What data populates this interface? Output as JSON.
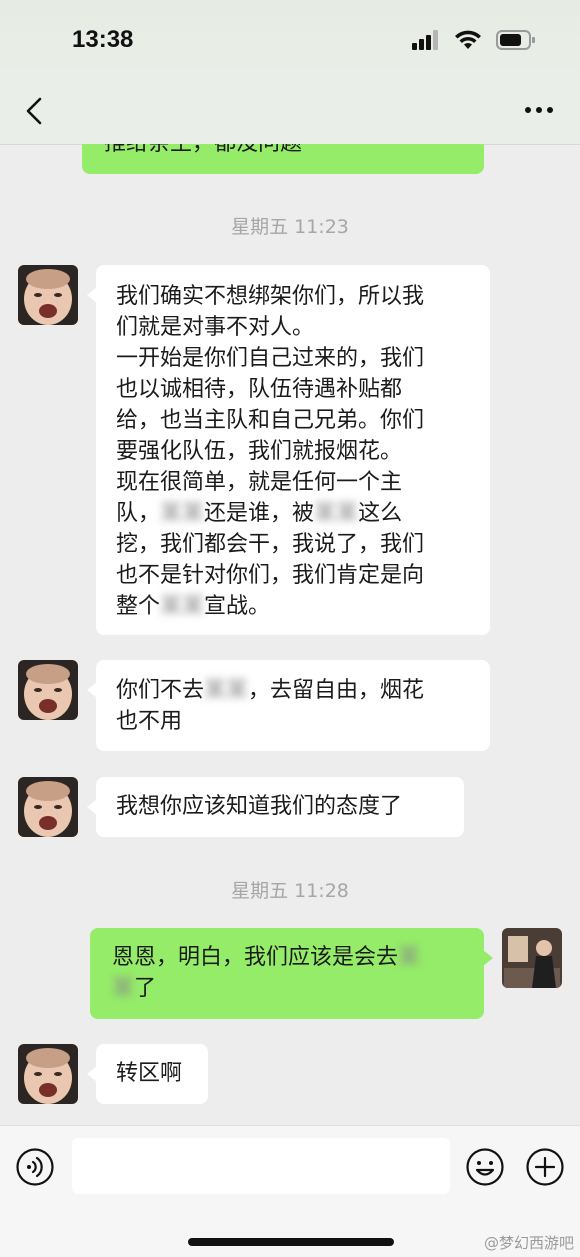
{
  "status_bar": {
    "time": "13:38",
    "icons": [
      "signal-icon",
      "wifi-icon",
      "battery-icon"
    ]
  },
  "nav": {
    "back_icon": "chevron-left-icon",
    "more_icon": "more-icon"
  },
  "messages": {
    "partial_sent": "推给亲王，都没问题",
    "ts1": "星期五 11:23",
    "msg1": {
      "line1": "我们确实不想绑架你们，所以我",
      "line2": "们就是对事不对人。",
      "line3": "一开始是你们自己过来的，我们",
      "line4": "也以诚相待，队伍待遇补贴都",
      "line5": "给，也当主队和自己兄弟。你们",
      "line6": "要强化队伍，我们就报烟花。",
      "line7": "现在很简单，就是任何一个主",
      "line8a": "队，",
      "line8_redacted_1": "某某",
      "line8b": "还是谁，被",
      "line8_redacted_2": "某某",
      "line8c": "这么",
      "line9": "挖，我们都会干，我说了，我们",
      "line10": "也不是针对你们，我们肯定是向",
      "line11a": "整个",
      "line11_redacted": "某某",
      "line11b": "宣战。"
    },
    "msg2": {
      "line1a": "你们不去",
      "line1_redacted": "某某",
      "line1b": "，去留自由，烟花",
      "line2": "也不用"
    },
    "msg3": "我想你应该知道我们的态度了",
    "ts2": "星期五 11:28",
    "msg4": {
      "line1a": "恩恩，明白，我们应该是会去",
      "line1_redacted": "某",
      "line2_redacted": "某",
      "line2b": "了"
    },
    "msg5": "转区啊"
  },
  "input": {
    "value": "",
    "placeholder": ""
  },
  "watermark": "@梦幻西游吧",
  "colors": {
    "sent_bubble": "#95ec69",
    "received_bubble": "#ffffff",
    "background": "#ededed"
  }
}
